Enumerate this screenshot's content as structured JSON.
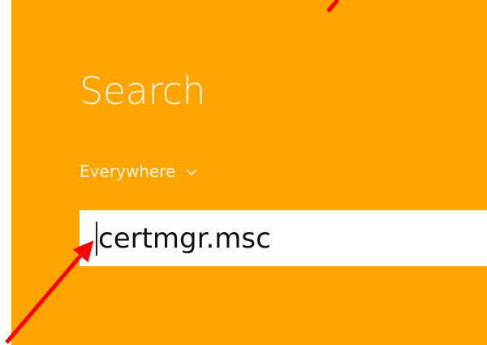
{
  "search_panel": {
    "title": "Search",
    "scope_label": "Everywhere",
    "scope_icon": "chevron-down-icon",
    "input_value": "certmgr.msc"
  },
  "colors": {
    "panel_bg": "#ffa500",
    "annotation_arrow": "#ff0000"
  }
}
